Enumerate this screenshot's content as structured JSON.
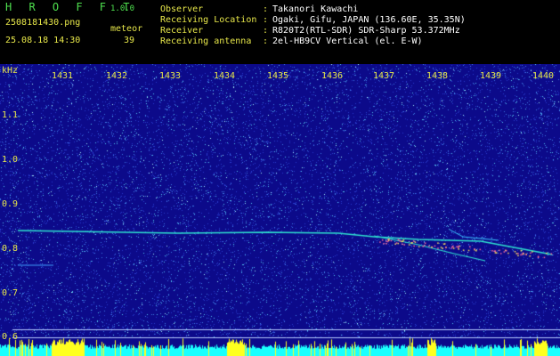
{
  "header": {
    "app_title": "H R O F F T",
    "version": "1.0.0",
    "filename": "2508181430.png",
    "datetime": "25.08.18 14:30",
    "meteor_label": "meteor",
    "meteor_count": "39",
    "info": [
      {
        "key": "Observer",
        "sep": ":",
        "value": "Takanori Kawachi"
      },
      {
        "key": "Receiving Location",
        "sep": ":",
        "value": "Ogaki, Gifu, JAPAN (136.60E, 35.35N)"
      },
      {
        "key": "Receiver",
        "sep": ":",
        "value": "R820T2(RTL-SDR) SDR-Sharp 53.372MHz"
      },
      {
        "key": "Receiving antenna",
        "sep": ":",
        "value": "2el-HB9CV Vertical (el. E-W)"
      }
    ]
  },
  "axes": {
    "y_unit": "kHz",
    "y_ticks": [
      "1.1",
      "1.0",
      "0.9",
      "0.8",
      "0.7",
      "0.6"
    ],
    "x_ticks": [
      "1431",
      "1432",
      "1433",
      "1434",
      "1435",
      "1436",
      "1437",
      "1438",
      "1439",
      "1440"
    ]
  },
  "colors": {
    "title_green": "#4ee04e",
    "label_yellow": "#e8e84a",
    "background_blue": "#0c0a8a",
    "noise_high": "#19ffff",
    "activity_bar": "#ffff1e"
  }
}
